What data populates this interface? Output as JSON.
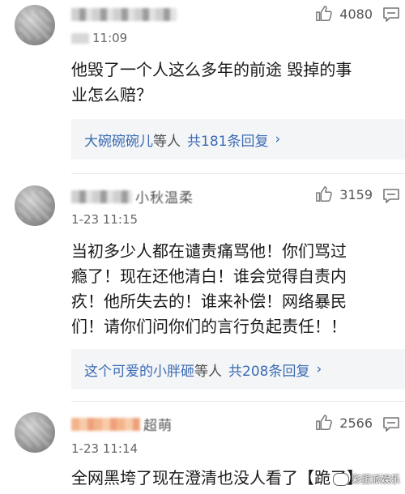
{
  "comments": [
    {
      "username_visible": "",
      "time": "11:09",
      "likes": "4080",
      "text_lines": [
        "他毁了一个人这么多年的前途 毁掉的事",
        "业怎么赔？"
      ],
      "reply": {
        "name": "大碗碗碗儿",
        "suffix": "等人",
        "count": "共181条回复",
        "chevron": "›"
      }
    },
    {
      "username_visible": "小秋温柔",
      "time": "1-23 11:15",
      "likes": "3159",
      "text_lines": [
        "当初多少人都在谴责痛骂他！你们骂过",
        "瘾了！现在还他清白！谁会觉得自责内",
        "疚！他所失去的！谁来补偿！网络暴民",
        "们！请你们问你们的言行负起责任！！"
      ],
      "reply": {
        "name": "这个可爱的小胖砸",
        "suffix": "等人",
        "count": "共208条回复",
        "chevron": "›"
      }
    },
    {
      "username_visible": "超萌",
      "time": "1-23 11:14",
      "likes": "2566",
      "text_lines": [
        "全网黑垮了现在澄清也没人看了【跪了】"
      ]
    }
  ],
  "watermark": "彩蛋派娱乐",
  "colors": {
    "link": "#3a6bb3",
    "reply_bg": "#f4f5f7",
    "text": "#1a1a1a",
    "meta": "#555555"
  },
  "icons": {
    "like": "thumbs-up-icon",
    "more": "comment-more-icon"
  }
}
